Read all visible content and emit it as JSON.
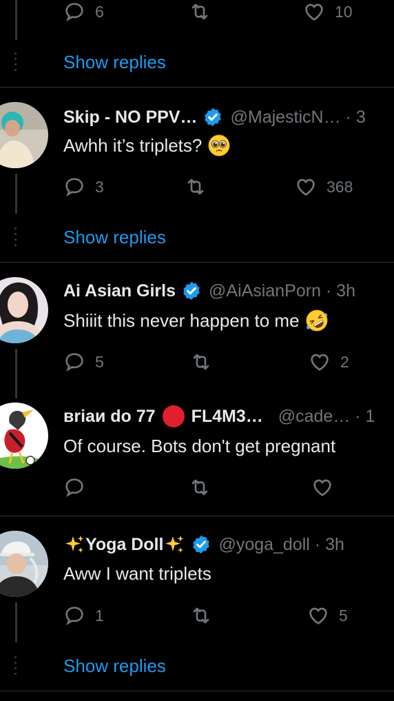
{
  "top": {
    "reply_count": "6",
    "like_count": "10",
    "show_replies": "Show replies"
  },
  "tweets": [
    {
      "name": "Skip - NO PPV…",
      "handle": "@MajesticN… · 3",
      "text": "Awhh it’s triplets?",
      "emoji": "pleading-face-emoji",
      "reply_count": "3",
      "like_count": "368",
      "show_replies": "Show replies"
    },
    {
      "name": "Ai Asian Girls",
      "handle": "@AiAsianPorn · 3h",
      "text": "Shiiit this never happen to me",
      "emoji": "rofl-emoji",
      "reply_count": "5",
      "like_count": "2"
    },
    {
      "name_part1": "вriaи do 77",
      "name_part2": "FL4M3…",
      "handle": "@cade… · 1",
      "text": "Of course. Bots don't get pregnant"
    },
    {
      "name": "Yoga Doll",
      "handle": "@yoga_doll · 3h",
      "text": "Aww I want triplets",
      "reply_count": "1",
      "like_count": "5",
      "show_replies": "Show replies"
    }
  ],
  "colors": {
    "background": "#000000",
    "text": "#e7e9ea",
    "muted": "#71767b",
    "link": "#1d9bf0",
    "verified": "#1d9bf0",
    "divider": "#2f3336"
  }
}
